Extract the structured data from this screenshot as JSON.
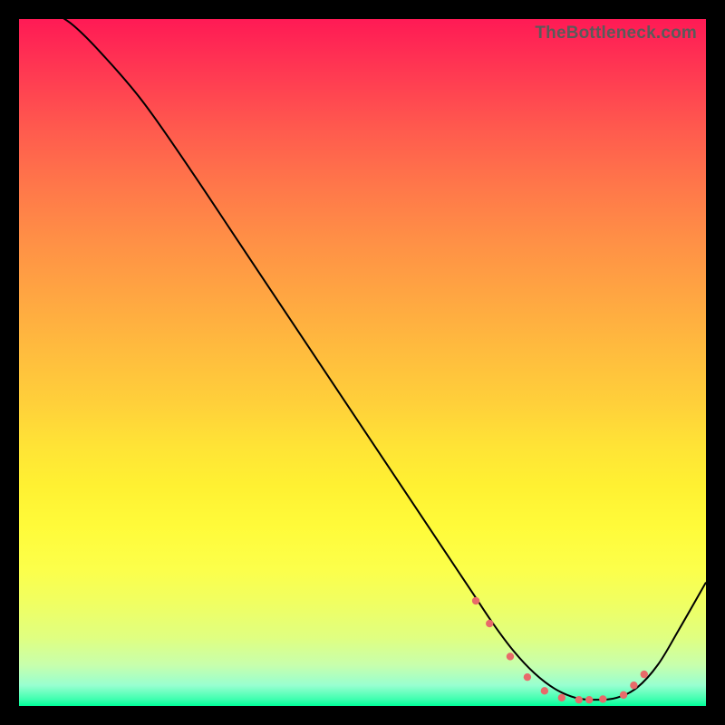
{
  "watermark": "TheBottleneck.com",
  "chart_data": {
    "type": "line",
    "title": "",
    "xlabel": "",
    "ylabel": "",
    "xlim": [
      0,
      100
    ],
    "ylim": [
      0,
      100
    ],
    "grid": false,
    "series": [
      {
        "name": "curve",
        "color": "#000000",
        "stroke_width": 2,
        "x": [
          5,
          8,
          12,
          18,
          25,
          32,
          40,
          48,
          56,
          62,
          66,
          69,
          72,
          75,
          78,
          81,
          84,
          87,
          90,
          93,
          96,
          100
        ],
        "y": [
          101,
          99,
          95,
          88,
          78,
          67.5,
          55.5,
          43.5,
          31.5,
          22.5,
          16.5,
          12,
          8,
          4.8,
          2.5,
          1.2,
          0.9,
          1.2,
          2.7,
          6,
          11,
          18
        ]
      }
    ],
    "markers": {
      "name": "dots",
      "color": "#e86a6a",
      "radius": 4.2,
      "x": [
        66.5,
        68.5,
        71.5,
        74.0,
        76.5,
        79.0,
        81.5,
        83.0,
        85.0,
        88.0,
        89.5,
        91.0
      ],
      "y": [
        15.3,
        12.0,
        7.2,
        4.2,
        2.2,
        1.2,
        0.9,
        0.9,
        1.0,
        1.6,
        3.0,
        4.6
      ]
    }
  }
}
